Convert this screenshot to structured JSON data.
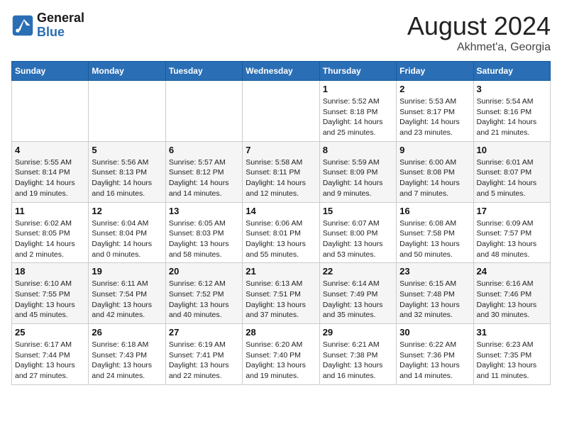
{
  "header": {
    "logo_line1": "General",
    "logo_line2": "Blue",
    "main_title": "August 2024",
    "subtitle": "Akhmet'a, Georgia"
  },
  "days_of_week": [
    "Sunday",
    "Monday",
    "Tuesday",
    "Wednesday",
    "Thursday",
    "Friday",
    "Saturday"
  ],
  "weeks": [
    [
      {
        "day": "",
        "info": ""
      },
      {
        "day": "",
        "info": ""
      },
      {
        "day": "",
        "info": ""
      },
      {
        "day": "",
        "info": ""
      },
      {
        "day": "1",
        "info": "Sunrise: 5:52 AM\nSunset: 8:18 PM\nDaylight: 14 hours\nand 25 minutes."
      },
      {
        "day": "2",
        "info": "Sunrise: 5:53 AM\nSunset: 8:17 PM\nDaylight: 14 hours\nand 23 minutes."
      },
      {
        "day": "3",
        "info": "Sunrise: 5:54 AM\nSunset: 8:16 PM\nDaylight: 14 hours\nand 21 minutes."
      }
    ],
    [
      {
        "day": "4",
        "info": "Sunrise: 5:55 AM\nSunset: 8:14 PM\nDaylight: 14 hours\nand 19 minutes."
      },
      {
        "day": "5",
        "info": "Sunrise: 5:56 AM\nSunset: 8:13 PM\nDaylight: 14 hours\nand 16 minutes."
      },
      {
        "day": "6",
        "info": "Sunrise: 5:57 AM\nSunset: 8:12 PM\nDaylight: 14 hours\nand 14 minutes."
      },
      {
        "day": "7",
        "info": "Sunrise: 5:58 AM\nSunset: 8:11 PM\nDaylight: 14 hours\nand 12 minutes."
      },
      {
        "day": "8",
        "info": "Sunrise: 5:59 AM\nSunset: 8:09 PM\nDaylight: 14 hours\nand 9 minutes."
      },
      {
        "day": "9",
        "info": "Sunrise: 6:00 AM\nSunset: 8:08 PM\nDaylight: 14 hours\nand 7 minutes."
      },
      {
        "day": "10",
        "info": "Sunrise: 6:01 AM\nSunset: 8:07 PM\nDaylight: 14 hours\nand 5 minutes."
      }
    ],
    [
      {
        "day": "11",
        "info": "Sunrise: 6:02 AM\nSunset: 8:05 PM\nDaylight: 14 hours\nand 2 minutes."
      },
      {
        "day": "12",
        "info": "Sunrise: 6:04 AM\nSunset: 8:04 PM\nDaylight: 14 hours\nand 0 minutes."
      },
      {
        "day": "13",
        "info": "Sunrise: 6:05 AM\nSunset: 8:03 PM\nDaylight: 13 hours\nand 58 minutes."
      },
      {
        "day": "14",
        "info": "Sunrise: 6:06 AM\nSunset: 8:01 PM\nDaylight: 13 hours\nand 55 minutes."
      },
      {
        "day": "15",
        "info": "Sunrise: 6:07 AM\nSunset: 8:00 PM\nDaylight: 13 hours\nand 53 minutes."
      },
      {
        "day": "16",
        "info": "Sunrise: 6:08 AM\nSunset: 7:58 PM\nDaylight: 13 hours\nand 50 minutes."
      },
      {
        "day": "17",
        "info": "Sunrise: 6:09 AM\nSunset: 7:57 PM\nDaylight: 13 hours\nand 48 minutes."
      }
    ],
    [
      {
        "day": "18",
        "info": "Sunrise: 6:10 AM\nSunset: 7:55 PM\nDaylight: 13 hours\nand 45 minutes."
      },
      {
        "day": "19",
        "info": "Sunrise: 6:11 AM\nSunset: 7:54 PM\nDaylight: 13 hours\nand 42 minutes."
      },
      {
        "day": "20",
        "info": "Sunrise: 6:12 AM\nSunset: 7:52 PM\nDaylight: 13 hours\nand 40 minutes."
      },
      {
        "day": "21",
        "info": "Sunrise: 6:13 AM\nSunset: 7:51 PM\nDaylight: 13 hours\nand 37 minutes."
      },
      {
        "day": "22",
        "info": "Sunrise: 6:14 AM\nSunset: 7:49 PM\nDaylight: 13 hours\nand 35 minutes."
      },
      {
        "day": "23",
        "info": "Sunrise: 6:15 AM\nSunset: 7:48 PM\nDaylight: 13 hours\nand 32 minutes."
      },
      {
        "day": "24",
        "info": "Sunrise: 6:16 AM\nSunset: 7:46 PM\nDaylight: 13 hours\nand 30 minutes."
      }
    ],
    [
      {
        "day": "25",
        "info": "Sunrise: 6:17 AM\nSunset: 7:44 PM\nDaylight: 13 hours\nand 27 minutes."
      },
      {
        "day": "26",
        "info": "Sunrise: 6:18 AM\nSunset: 7:43 PM\nDaylight: 13 hours\nand 24 minutes."
      },
      {
        "day": "27",
        "info": "Sunrise: 6:19 AM\nSunset: 7:41 PM\nDaylight: 13 hours\nand 22 minutes."
      },
      {
        "day": "28",
        "info": "Sunrise: 6:20 AM\nSunset: 7:40 PM\nDaylight: 13 hours\nand 19 minutes."
      },
      {
        "day": "29",
        "info": "Sunrise: 6:21 AM\nSunset: 7:38 PM\nDaylight: 13 hours\nand 16 minutes."
      },
      {
        "day": "30",
        "info": "Sunrise: 6:22 AM\nSunset: 7:36 PM\nDaylight: 13 hours\nand 14 minutes."
      },
      {
        "day": "31",
        "info": "Sunrise: 6:23 AM\nSunset: 7:35 PM\nDaylight: 13 hours\nand 11 minutes."
      }
    ]
  ]
}
